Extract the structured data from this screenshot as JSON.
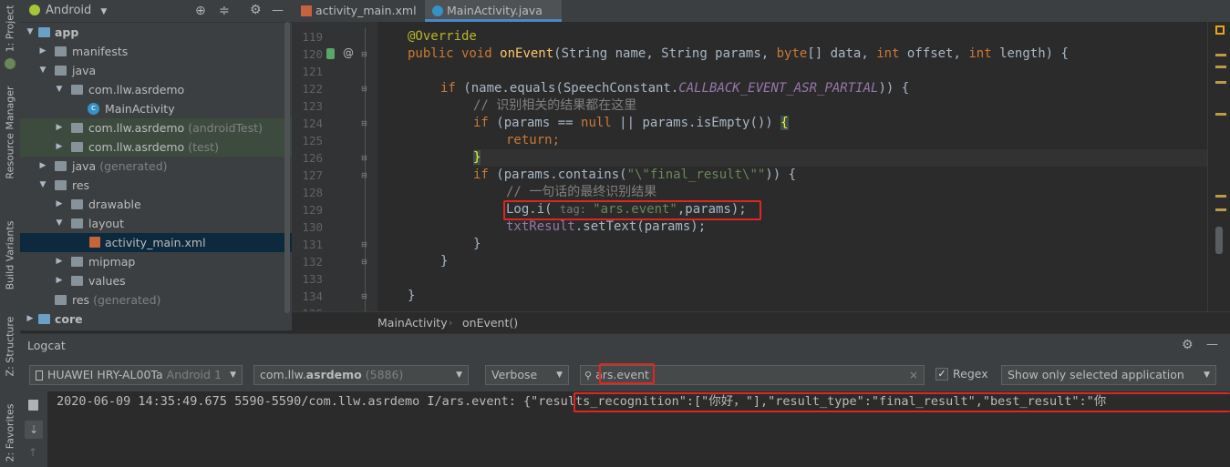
{
  "left_strip": {
    "tabs": [
      "1: Project",
      "Resource Manager",
      "Build Variants",
      "Z: Structure",
      "2: Favorites"
    ]
  },
  "project": {
    "view_selector": "Android",
    "tree": [
      {
        "label": "app",
        "extra": ""
      },
      {
        "label": "manifests",
        "extra": ""
      },
      {
        "label": "java",
        "extra": ""
      },
      {
        "label": "com.llw.asrdemo",
        "extra": ""
      },
      {
        "label": "MainActivity",
        "extra": ""
      },
      {
        "label": "com.llw.asrdemo",
        "extra": "(androidTest)"
      },
      {
        "label": "com.llw.asrdemo",
        "extra": "(test)"
      },
      {
        "label": "java",
        "extra": "(generated)"
      },
      {
        "label": "res",
        "extra": ""
      },
      {
        "label": "drawable",
        "extra": ""
      },
      {
        "label": "layout",
        "extra": ""
      },
      {
        "label": "activity_main.xml",
        "extra": ""
      },
      {
        "label": "mipmap",
        "extra": ""
      },
      {
        "label": "values",
        "extra": ""
      },
      {
        "label": "res",
        "extra": "(generated)"
      },
      {
        "label": "core",
        "extra": ""
      }
    ]
  },
  "editor": {
    "tabs": [
      "activity_main.xml",
      "MainActivity.java"
    ],
    "active_tab": "MainActivity.java",
    "line_numbers": [
      "119",
      "120",
      "121",
      "122",
      "123",
      "124",
      "125",
      "126",
      "127",
      "128",
      "129",
      "130",
      "131",
      "132",
      "133",
      "134",
      "135"
    ],
    "code": {
      "l119": "@Override",
      "l120_kw1": "public void ",
      "l120_fn": "onEvent",
      "l120_rest1": "(String name, String params, ",
      "l120_kw2": "byte",
      "l120_rest2": "[] data, ",
      "l120_kw3": "int",
      "l120_rest3": " offset, ",
      "l120_kw4": "int",
      "l120_rest4": " length) {",
      "l122_kw": "if",
      "l122_a": " (name.equals(SpeechConstant.",
      "l122_const": "CALLBACK_EVENT_ASR_PARTIAL",
      "l122_b": ")) {",
      "l123": "// 识别相关的结果都在这里",
      "l124_kw": "if",
      "l124_a": " (params == ",
      "l124_null": "null",
      "l124_b": " || params.isEmpty()) ",
      "l124_brace": "{",
      "l125": "return;",
      "l126": "}",
      "l127_kw": "if",
      "l127_a": " (params.contains(",
      "l127_str": "\"\\\"final_result\\\"\"",
      "l127_b": ")) {",
      "l128": "// 一句话的最终识别结果",
      "l129_a": "Log.i( ",
      "l129_hint": "tag: ",
      "l129_str": "\"ars.event\"",
      "l129_b": ",params);",
      "l130_fld": "txtResult",
      "l130_b": ".setText(params);",
      "l131": "}",
      "l132": "}",
      "l134": "}"
    },
    "breadcrumb": [
      "MainActivity",
      "onEvent()"
    ]
  },
  "logcat": {
    "title": "Logcat",
    "device": "HUAWEI HRY-AL00Ta",
    "device_os": "Android 1",
    "process": "com.llw.",
    "process_bold": "asrdemo",
    "process_pid": "(5886)",
    "level": "Verbose",
    "search_value": "ars.event",
    "regex_label": "Regex",
    "regex_checked": true,
    "filter_option": "Show only selected application",
    "log_prefix": "2020-06-09 14:35:49.675 5590-5590/com.llw.asrdemo I/ars.event: ",
    "log_payload": "{\"results_recognition\":[\"你好，\"],\"result_type\":\"final_result\",\"best_result\":\"你"
  },
  "colors": {
    "highlight": "#e0261f",
    "accent_marker": "#bd9b43"
  }
}
